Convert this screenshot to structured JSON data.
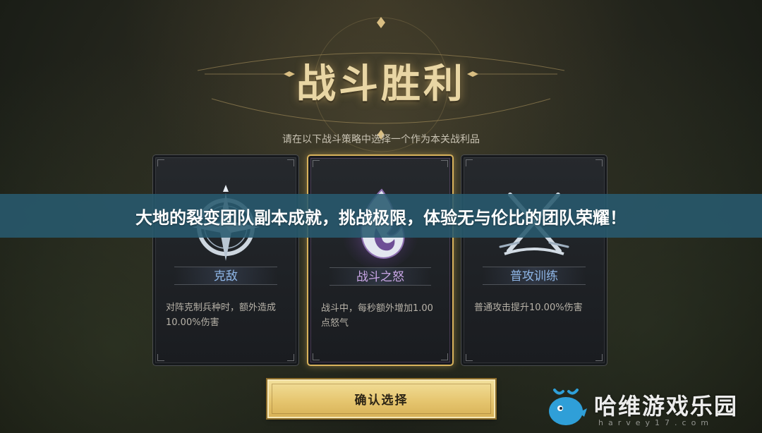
{
  "header": {
    "title": "战斗胜利",
    "subtitle": "请在以下战斗策略中选择一个作为本关战利品"
  },
  "cards": [
    {
      "name": "克敌",
      "description": "对阵克制兵种时，额外造成10.00%伤害",
      "icon": "compass-star-icon",
      "name_color": "#8fb7e8"
    },
    {
      "name": "战斗之怒",
      "description": "战斗中，每秒额外增加1.00点怒气",
      "icon": "purple-flame-icon",
      "name_color": "#c9a6e6",
      "selected": true
    },
    {
      "name": "普攻训练",
      "description": "普通攻击提升10.00%伤害",
      "icon": "crossed-swords-icon",
      "name_color": "#8fb7e8"
    }
  ],
  "confirm_button": {
    "label": "确认选择"
  },
  "banner": {
    "text": "大地的裂变团队副本成就，挑战极限，体验无与伦比的团队荣耀！"
  },
  "watermark": {
    "text": "哈维游戏乐园",
    "url": "harvey17.com"
  },
  "colors": {
    "accent_gold": "#e6c670",
    "banner_bg": "#285a6e"
  }
}
